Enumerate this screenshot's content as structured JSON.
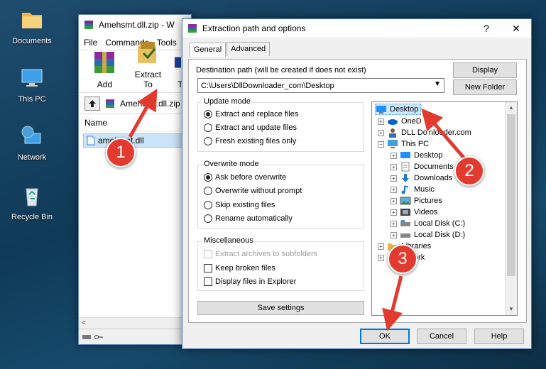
{
  "desktop": {
    "icons": [
      {
        "label": "Documents"
      },
      {
        "label": "This PC"
      },
      {
        "label": "Network"
      },
      {
        "label": "Recycle Bin"
      }
    ]
  },
  "winrar": {
    "title": "Amehsmt.dll.zip - W",
    "menu": [
      "File",
      "Commands",
      "Tools"
    ],
    "toolbar": {
      "add": "Add",
      "extract_to": "Extract To",
      "third": "T"
    },
    "address": "Amehsmt.dll.zip",
    "column_name": "Name",
    "file": "amehsmt.dll",
    "scroll_left": "<"
  },
  "dialog": {
    "title": "Extraction path and options",
    "help": "?",
    "close": "✕",
    "tabs": [
      "General",
      "Advanced"
    ],
    "dest_label": "Destination path (will be created if does not exist)",
    "dest_value": "C:\\Users\\DllDownloader_com\\Desktop",
    "display_button": "Display",
    "new_folder_button": "New Folder",
    "update_mode": {
      "title": "Update mode",
      "options": [
        "Extract and replace files",
        "Extract and update files",
        "Fresh existing files only"
      ],
      "selected": 0
    },
    "overwrite_mode": {
      "title": "Overwrite mode",
      "options": [
        "Ask before overwrite",
        "Overwrite without prompt",
        "Skip existing files",
        "Rename automatically"
      ],
      "selected": 0
    },
    "misc": {
      "title": "Miscellaneous",
      "options": [
        "Extract archives to subfolders",
        "Keep broken files",
        "Display files in Explorer"
      ]
    },
    "save_settings": "Save settings",
    "tree": [
      "Desktop",
      "OneD",
      "DLL Do",
      "nloader.com",
      "This PC",
      "Desktop",
      "Documents",
      "Downloads",
      "Music",
      "Pictures",
      "Videos",
      "Local Disk (C:)",
      "Local Disk (D:)",
      "Libraries",
      "ork"
    ],
    "ok": "OK",
    "cancel": "Cancel",
    "help_button": "Help"
  },
  "callouts": [
    "1",
    "2",
    "3"
  ],
  "colors": {
    "callout": "#e23a2e",
    "selection": "#cce8ff",
    "accent": "#0078d7"
  }
}
